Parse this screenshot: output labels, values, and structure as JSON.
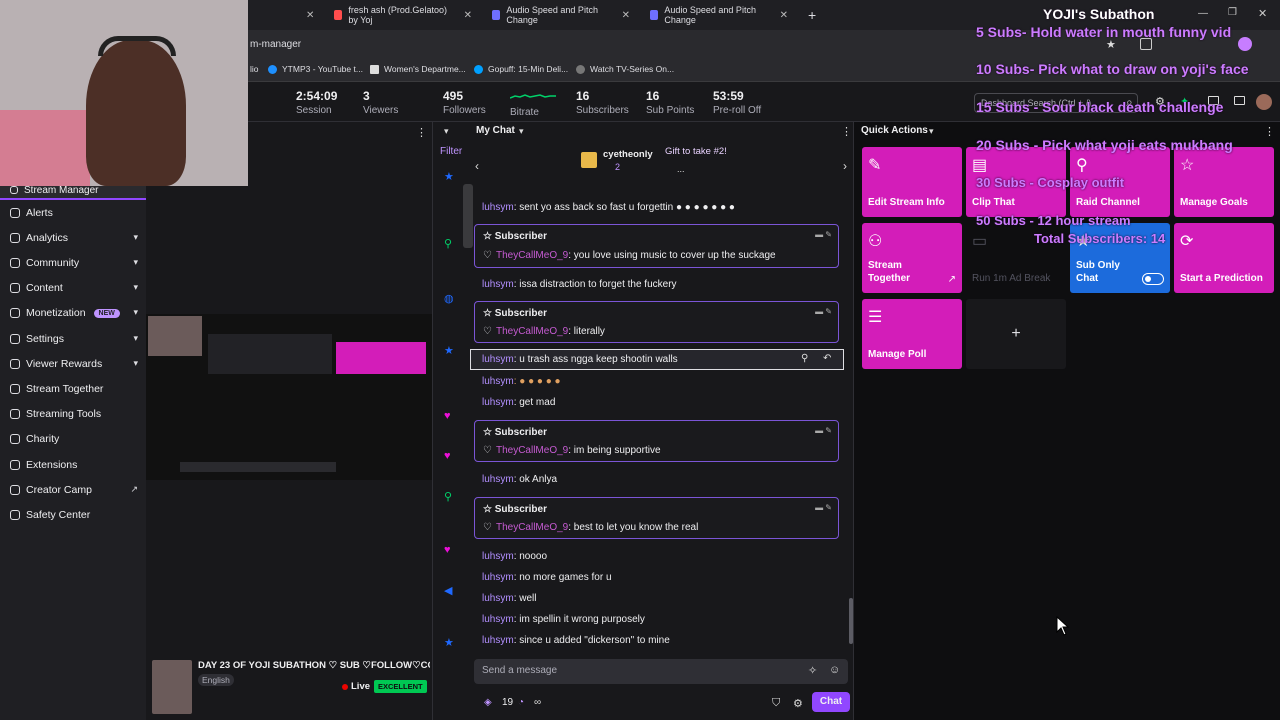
{
  "browser": {
    "tabs": [
      {
        "title": "fresh ash (Prod.Gelatoo) by Yoj",
        "icon_color": "#ff4d4d"
      },
      {
        "title": "Audio Speed and Pitch Change",
        "icon_color": "#6f6fff"
      },
      {
        "title": "Audio Speed and Pitch Change",
        "icon_color": "#6f6fff"
      }
    ],
    "url_fragment": "m-manager",
    "bookmarks": [
      "lio",
      "YTMP3 - YouTube t...",
      "Women's Departme...",
      "Gopuff: 15-Min Deli...",
      "Watch TV-Series On..."
    ]
  },
  "stats": [
    {
      "value": "2:54:09",
      "label": "Session"
    },
    {
      "value": "3",
      "label": "Viewers"
    },
    {
      "value": "495",
      "label": "Followers"
    },
    {
      "value": "",
      "label": "Bitrate"
    },
    {
      "value": "16",
      "label": "Subscribers"
    },
    {
      "value": "16",
      "label": "Sub Points"
    },
    {
      "value": "53:59",
      "label": "Pre-roll Off"
    }
  ],
  "dashboard_search_placeholder": "Dashboard Search (Ctrl + /)",
  "sidebar": {
    "header": "Stream Manager",
    "items": [
      {
        "label": "Alerts",
        "chevron": false
      },
      {
        "label": "Analytics",
        "chevron": true
      },
      {
        "label": "Community",
        "chevron": true
      },
      {
        "label": "Content",
        "chevron": true
      },
      {
        "label": "Monetization",
        "chevron": true,
        "badge": "NEW"
      },
      {
        "label": "Settings",
        "chevron": true
      },
      {
        "label": "Viewer Rewards",
        "chevron": true
      },
      {
        "label": "Stream Together",
        "chevron": false
      },
      {
        "label": "Streaming Tools",
        "chevron": false
      },
      {
        "label": "Charity",
        "chevron": false
      },
      {
        "label": "Extensions",
        "chevron": false
      },
      {
        "label": "Creator Camp",
        "chevron": false
      },
      {
        "label": "Safety Center",
        "chevron": false
      }
    ]
  },
  "stream_info": {
    "title": "DAY 23 OF YOJI SUBATHON ♡ SUB ♡FOLLOW♡CO",
    "language": "English",
    "live_label": "Live",
    "quality": "EXCELLENT"
  },
  "chat": {
    "panel_title": "My Chat",
    "filter_label": "Filter",
    "banner": {
      "user": "cyetheonly",
      "count": "2",
      "gift_text": "Gift to take #2!",
      "ellipsis": "..."
    },
    "subscriber_label": "Subscriber",
    "messages": [
      {
        "user": "luhsym",
        "text": ": sent yo ass back so fast u forgettin ● ● ● ● ● ● ●"
      },
      {
        "user": "TheyCallMeO_9",
        "text": ": you love using music to cover up the suckage",
        "sub": true
      },
      {
        "user": "luhsym",
        "text": ": issa distraction to forget the fuckery"
      },
      {
        "user": "TheyCallMeO_9",
        "text": ": literally",
        "sub": true
      },
      {
        "user": "luhsym",
        "text": ": u trash ass ngga keep shootin walls"
      },
      {
        "user": "luhsym",
        "text": ": ● ● ● ● ●"
      },
      {
        "user": "luhsym",
        "text": ": get mad"
      },
      {
        "user": "TheyCallMeO_9",
        "text": ": im being supportive",
        "sub": true
      },
      {
        "user": "luhsym",
        "text": ": ok Anlya"
      },
      {
        "user": "TheyCallMeO_9",
        "text": ": best to let you know the real",
        "sub": true
      },
      {
        "user": "luhsym",
        "text": ": noooo"
      },
      {
        "user": "luhsym",
        "text": ": no more games for u"
      },
      {
        "user": "luhsym",
        "text": ": well"
      },
      {
        "user": "luhsym",
        "text": ": im spellin it wrong purposely"
      },
      {
        "user": "luhsym",
        "text": ": since u added \"dickerson\" to mine"
      }
    ],
    "input_placeholder": "Send a message",
    "points": "19",
    "chat_button": "Chat"
  },
  "quick_actions": {
    "title": "Quick Actions",
    "tiles": [
      {
        "label": "Edit Stream Info",
        "icon": "pencil-icon",
        "color": "#d31db9"
      },
      {
        "label": "Clip That",
        "icon": "clapper-icon",
        "color": "#d31db9"
      },
      {
        "label": "Raid Channel",
        "icon": "radar-icon",
        "color": "#d31db9"
      },
      {
        "label": "Manage Goals",
        "icon": "star-icon",
        "color": "#d31db9"
      },
      {
        "label": "Stream Together",
        "icon": "person-add-icon",
        "color": "#d31db9"
      },
      {
        "label": "Run 1m Ad Break",
        "icon": "ad-icon",
        "color": "#0e0e10"
      },
      {
        "label": "Sub Only Chat",
        "icon": "star-icon",
        "color": "#1c6bdc"
      },
      {
        "label": "Start a Prediction",
        "icon": "prediction-icon",
        "color": "#d31db9"
      },
      {
        "label": "Manage Poll",
        "icon": "poll-icon",
        "color": "#d31db9"
      }
    ],
    "add_label": "+"
  },
  "overlay": {
    "title": "YOJI's Subathon",
    "goals": [
      "5 Subs- Hold water in mouth funny vid",
      "10 Subs- Pick what to draw on yoji's face",
      "15 Subs - Sour black death challenge",
      "20 Subs - Pick what yoji eats mukbang",
      "30 Subs - Cosplay outfit",
      "50 Subs - 12 hour stream"
    ],
    "total": "Total Subscribers: 14"
  }
}
